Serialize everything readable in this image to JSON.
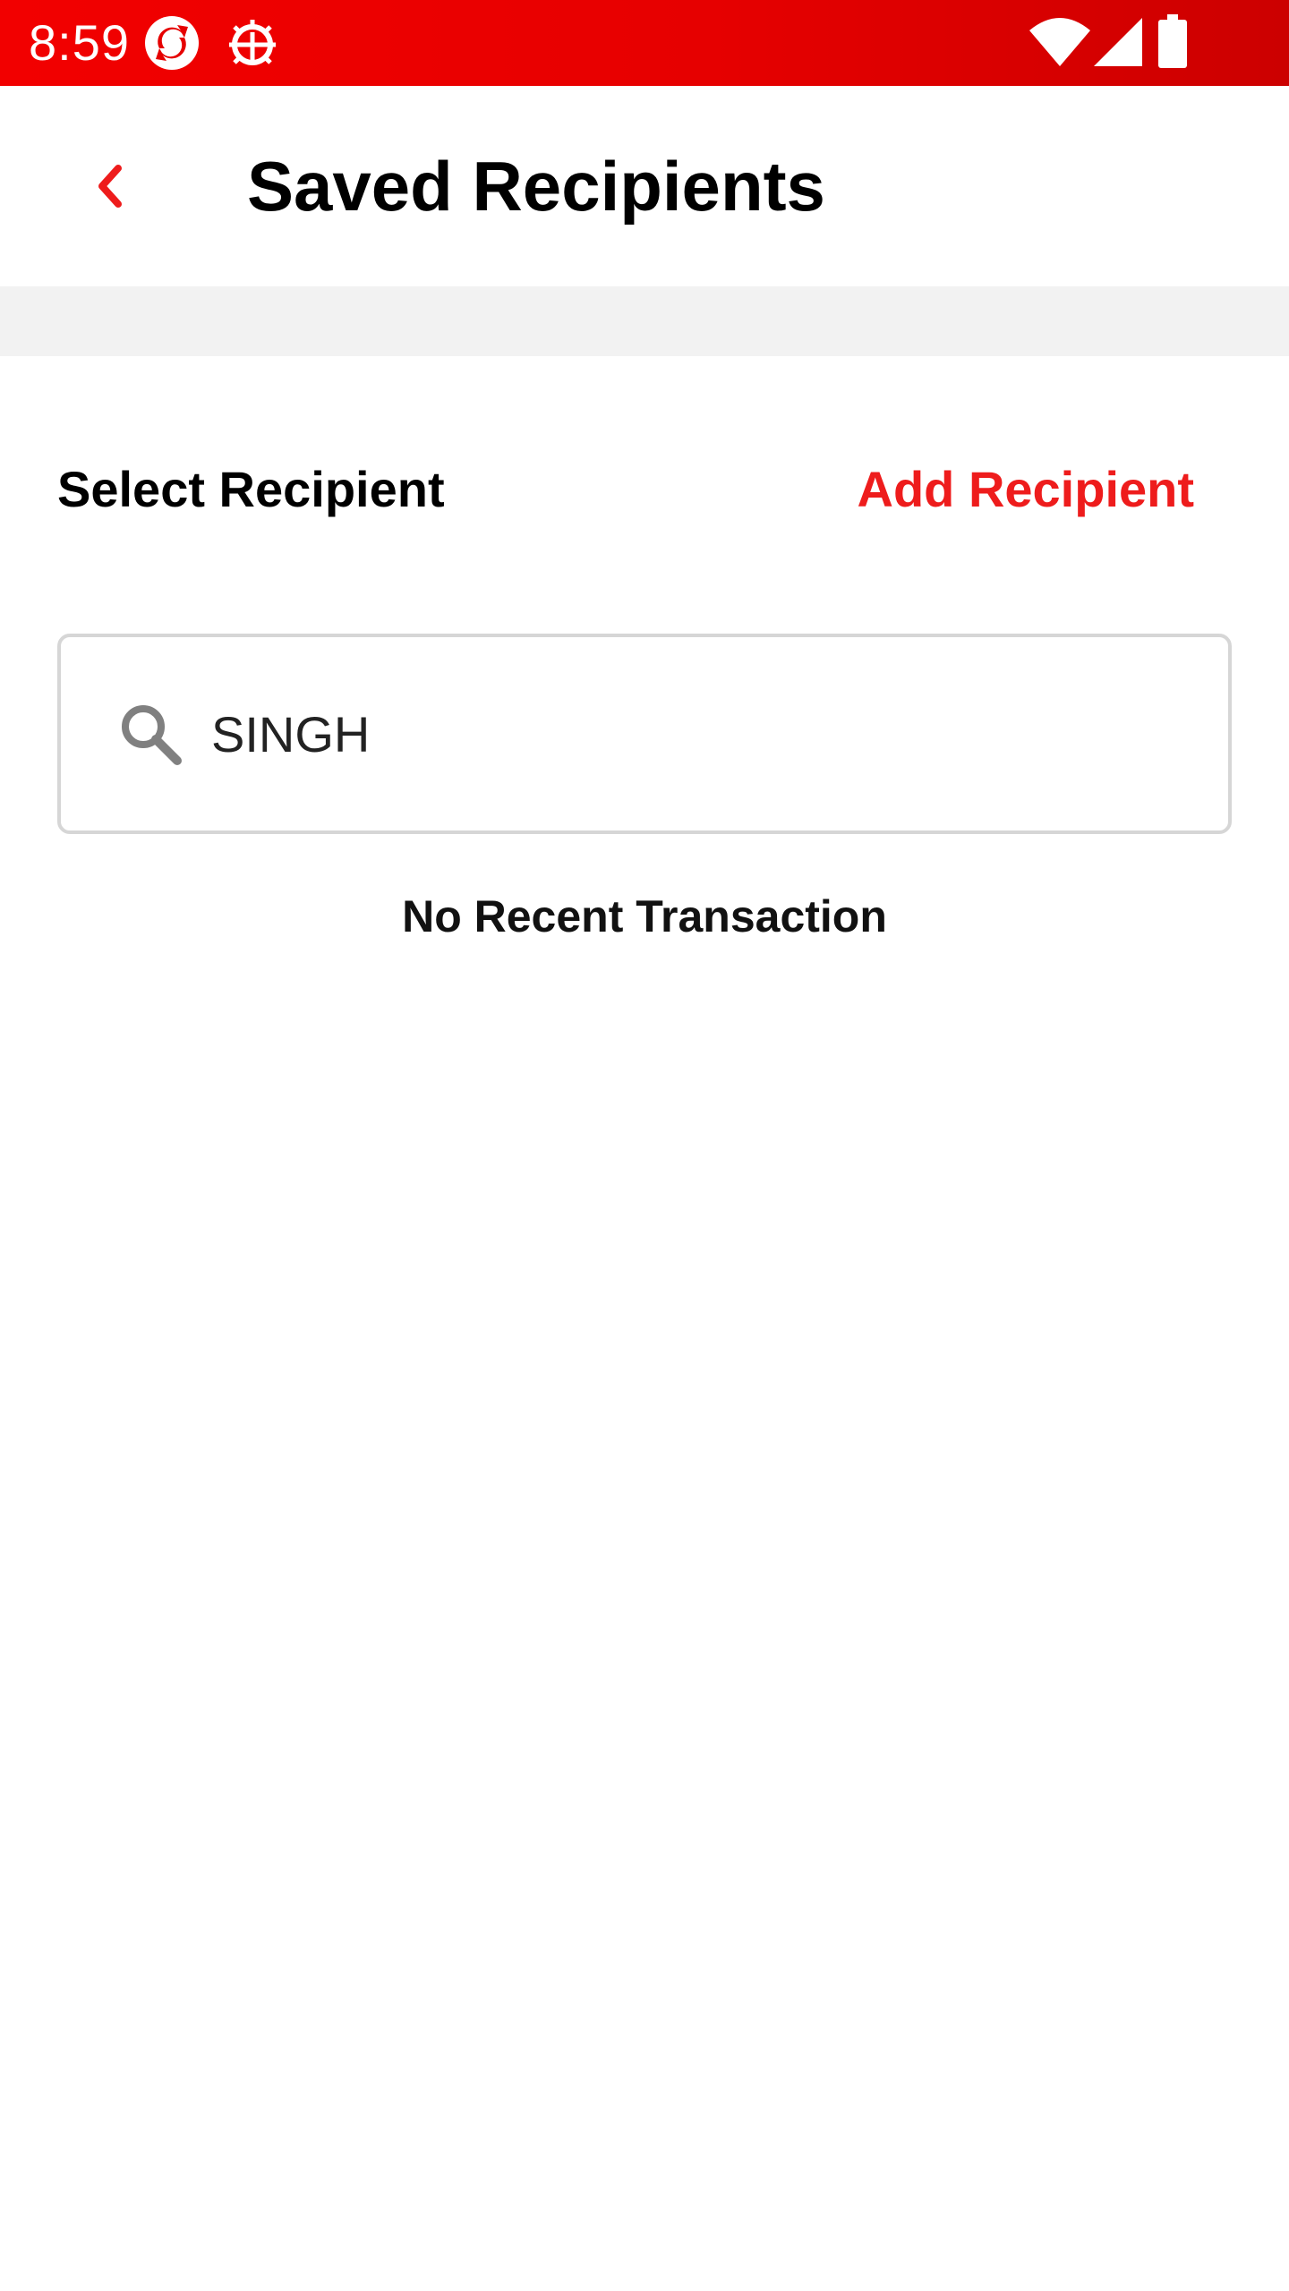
{
  "status_bar": {
    "time": "8:59",
    "left_icons": [
      "sync-app-icon",
      "android-debug-icon"
    ],
    "right_icons": [
      "wifi-icon",
      "cellular-signal-icon",
      "battery-icon"
    ],
    "background": "#e60000"
  },
  "app_bar": {
    "back_icon": "chevron-left-icon",
    "title": "Saved Recipients"
  },
  "recipients": {
    "section_title": "Select Recipient",
    "add_label": "Add Recipient",
    "search": {
      "icon": "search-icon",
      "value": "SINGH",
      "placeholder": ""
    },
    "empty_message": "No Recent Transaction"
  },
  "colors": {
    "accent": "#ee1c1c",
    "divider": "#f2f2f2",
    "border": "#d6d6d6"
  }
}
